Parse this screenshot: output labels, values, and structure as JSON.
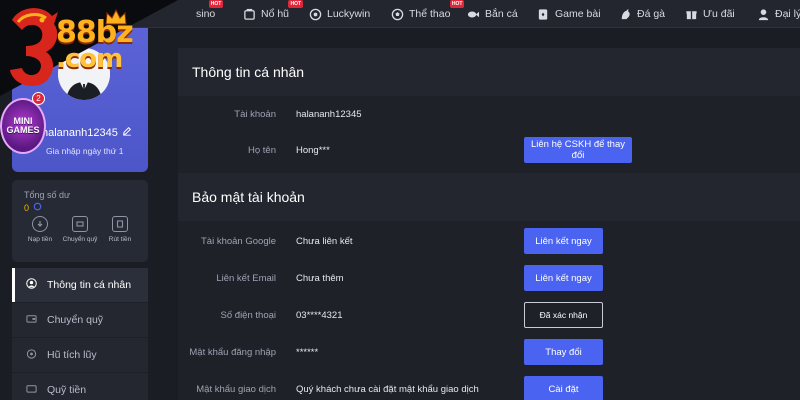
{
  "nav": {
    "items": [
      {
        "label": "sino",
        "icon": "casino-icon",
        "hot": true
      },
      {
        "label": "Nổ hũ",
        "icon": "slot-icon",
        "hot": true
      },
      {
        "label": "Luckywin",
        "icon": "luckywin-icon",
        "hot": false
      },
      {
        "label": "Thể thao",
        "icon": "soccer-ball-icon",
        "hot": true
      },
      {
        "label": "Bắn cá",
        "icon": "fish-icon",
        "hot": false
      },
      {
        "label": "Game bài",
        "icon": "cards-icon",
        "hot": false
      },
      {
        "label": "Đá gà",
        "icon": "rooster-icon",
        "hot": false
      },
      {
        "label": "Ưu đãi",
        "icon": "gift-icon",
        "hot": false
      },
      {
        "label": "Đại lý",
        "icon": "agent-icon",
        "hot": false
      }
    ],
    "hot_text": "HOT"
  },
  "logo": {
    "line1": "88bz",
    "line2": ".com"
  },
  "minigames": {
    "text": "MINI GAMES",
    "count": "2"
  },
  "profile": {
    "username": "halananh12345",
    "join_text": "Gia nhập ngày thứ 1"
  },
  "balance": {
    "label": "Tổng số dư",
    "value": "0",
    "actions": [
      {
        "label": "Nạp tiền",
        "icon": "deposit-icon"
      },
      {
        "label": "Chuyển quỹ",
        "icon": "transfer-icon"
      },
      {
        "label": "Rút tiền",
        "icon": "withdraw-icon"
      }
    ]
  },
  "sidebar_menu": [
    {
      "label": "Thông tin cá nhân",
      "icon": "user-icon",
      "active": true
    },
    {
      "label": "Chuyển quỹ",
      "icon": "wallet-icon",
      "active": false
    },
    {
      "label": "Hũ tích lũy",
      "icon": "jar-icon",
      "active": false
    },
    {
      "label": "Quỹ tiền",
      "icon": "money-icon",
      "active": false
    }
  ],
  "personal": {
    "title": "Thông tin cá nhân",
    "rows": [
      {
        "label": "Tài khoản",
        "value": "halananh12345",
        "button": ""
      },
      {
        "label": "Họ tên",
        "value": "Hong***",
        "button": "Liên hệ CSKH để thay đổi"
      }
    ]
  },
  "security": {
    "title": "Bảo mật tài khoản",
    "rows": [
      {
        "label": "Tài khoản Google",
        "value": "Chưa liên kết",
        "button": "Liên kết ngay",
        "style": "filled"
      },
      {
        "label": "Liên kết Email",
        "value": "Chưa thêm",
        "button": "Liên kết ngay",
        "style": "filled"
      },
      {
        "label": "Số điện thoại",
        "value": "03****4321",
        "button": "Đã xác nhận",
        "style": "outline"
      },
      {
        "label": "Mật khẩu đăng nhập",
        "value": "******",
        "button": "Thay đổi",
        "style": "filled"
      },
      {
        "label": "Mật khẩu giao dịch",
        "value": "Quý khách chưa cài đặt mật khẩu giao dịch",
        "button": "Cài đặt",
        "style": "filled"
      }
    ]
  },
  "colors": {
    "accent": "#4a63f0",
    "profile_card": "#5b63d6",
    "balance_value": "#f0b400",
    "hot_badge": "#e0263a"
  }
}
